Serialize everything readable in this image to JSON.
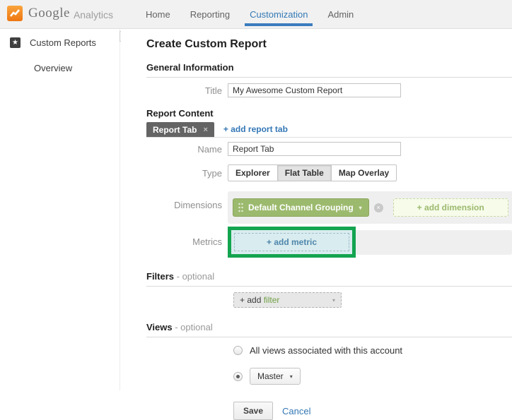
{
  "topbar": {
    "brand": "Google",
    "product": "Analytics",
    "nav": [
      {
        "label": "Home",
        "active": false
      },
      {
        "label": "Reporting",
        "active": false
      },
      {
        "label": "Customization",
        "active": true
      },
      {
        "label": "Admin",
        "active": false
      }
    ]
  },
  "sidebar": {
    "section_label": "Custom Reports",
    "overview_label": "Overview"
  },
  "main": {
    "page_title": "Create Custom Report",
    "general": {
      "heading": "General Information",
      "title_label": "Title",
      "title_value": "My Awesome Custom Report"
    },
    "report_content": {
      "heading": "Report Content",
      "tab_label": "Report Tab",
      "add_tab_link": "+ add report tab",
      "name_label": "Name",
      "name_value": "Report Tab",
      "type_label": "Type",
      "type_options": [
        {
          "label": "Explorer",
          "selected": false
        },
        {
          "label": "Flat Table",
          "selected": true
        },
        {
          "label": "Map Overlay",
          "selected": false
        }
      ],
      "dimensions_label": "Dimensions",
      "dimension_pill_label": "Default Channel Grouping",
      "add_dimension_label": "+ add dimension",
      "metrics_label": "Metrics",
      "add_metric_label": "+ add metric"
    },
    "filters": {
      "heading": "Filters",
      "optional_suffix": " - optional",
      "add_prefix": "+ add ",
      "add_target": "filter"
    },
    "views": {
      "heading": "Views",
      "optional_suffix": " - optional",
      "option_all_label": "All views associated with this account",
      "option_selected_value": "Master"
    },
    "actions": {
      "save_label": "Save",
      "cancel_label": "Cancel"
    }
  },
  "icons": {
    "caret_down": "▾",
    "collapse_left": "◂",
    "close": "×",
    "remove": "×",
    "star": "★"
  },
  "colors": {
    "accent_blue": "#3379b5",
    "dimension_green": "#9cba6e",
    "highlight_green": "#13a450",
    "metric_blue": "#4e86ab",
    "chip_gray": "#646464",
    "logo_orange": "#ee7612"
  }
}
